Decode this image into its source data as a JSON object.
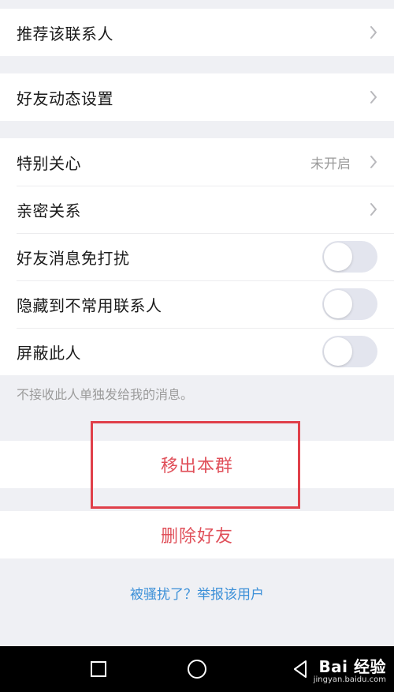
{
  "rows": {
    "recommend": {
      "label": "推荐该联系人"
    },
    "moments": {
      "label": "好友动态设置"
    },
    "special_care": {
      "label": "特别关心",
      "value": "未开启"
    },
    "intimacy": {
      "label": "亲密关系"
    },
    "mute": {
      "label": "好友消息免打扰",
      "enabled": false
    },
    "hide": {
      "label": "隐藏到不常用联系人",
      "enabled": false
    },
    "block": {
      "label": "屏蔽此人",
      "enabled": false
    }
  },
  "block_hint": "不接收此人单独发给我的消息。",
  "actions": {
    "remove_from_group": "移出本群",
    "delete_friend": "删除好友"
  },
  "report_link": "被骚扰了？举报该用户",
  "watermark": {
    "main": "Bai 经验",
    "sub": "jingyan.baidu.com"
  },
  "colors": {
    "danger": "#e0505a",
    "link": "#3c90d8",
    "highlight": "#e0404a"
  }
}
